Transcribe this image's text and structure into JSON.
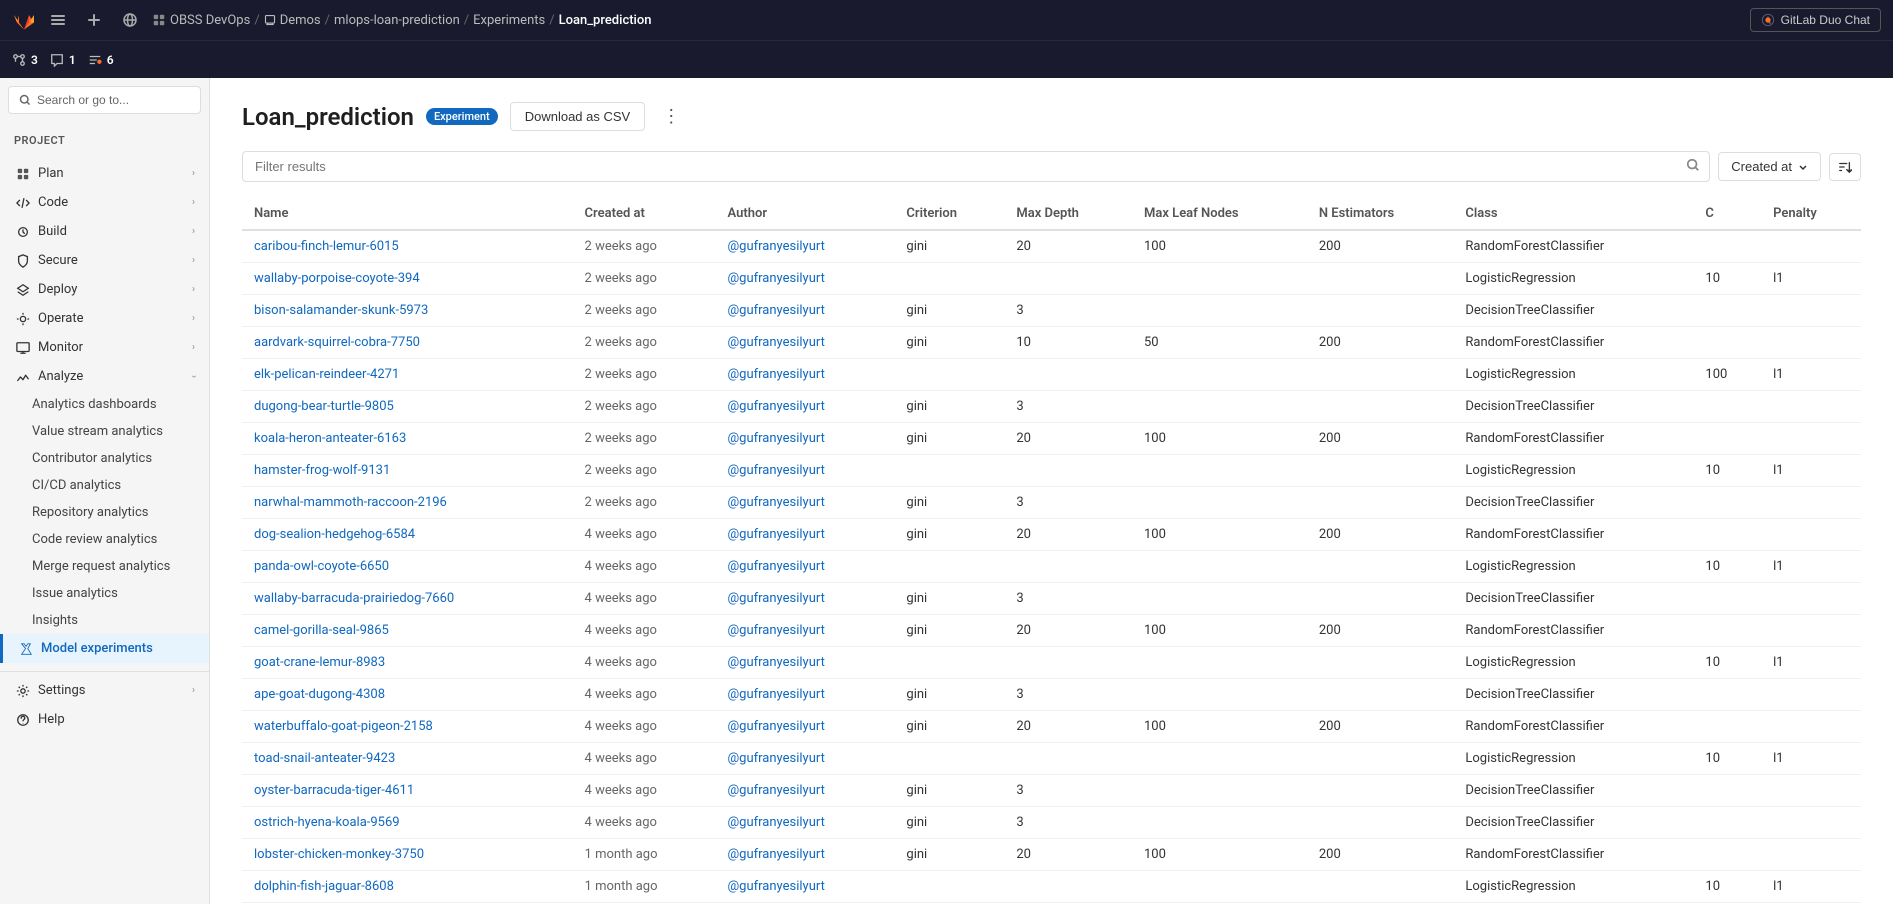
{
  "topbar": {
    "breadcrumbs": [
      {
        "label": "OBSS DevOps",
        "href": "#"
      },
      {
        "label": "Demos",
        "href": "#"
      },
      {
        "label": "mlops-loan-prediction",
        "href": "#"
      },
      {
        "label": "Experiments",
        "href": "#"
      },
      {
        "label": "Loan_prediction",
        "href": "#",
        "current": true
      }
    ],
    "duo_chat_label": "GitLab Duo Chat"
  },
  "notif_bar": {
    "items": [
      {
        "icon": "merge-request-icon",
        "count": "3",
        "label": "3"
      },
      {
        "icon": "code-review-icon",
        "count": "1",
        "label": "1"
      },
      {
        "icon": "todo-icon",
        "count": "6",
        "label": "6"
      }
    ]
  },
  "sidebar": {
    "search_placeholder": "Search or go to...",
    "project_label": "Project",
    "nav_items": [
      {
        "label": "Plan",
        "has_children": true
      },
      {
        "label": "Code",
        "has_children": true
      },
      {
        "label": "Build",
        "has_children": true
      },
      {
        "label": "Secure",
        "has_children": true
      },
      {
        "label": "Deploy",
        "has_children": true
      },
      {
        "label": "Operate",
        "has_children": true
      },
      {
        "label": "Monitor",
        "has_children": true
      },
      {
        "label": "Analyze",
        "has_children": true,
        "expanded": true
      }
    ],
    "analyze_sub_items": [
      {
        "label": "Analytics dashboards",
        "active": false
      },
      {
        "label": "Value stream analytics",
        "active": false
      },
      {
        "label": "Contributor analytics",
        "active": false
      },
      {
        "label": "CI/CD analytics",
        "active": false
      },
      {
        "label": "Repository analytics",
        "active": false
      },
      {
        "label": "Code review analytics",
        "active": false
      },
      {
        "label": "Merge request analytics",
        "active": false
      },
      {
        "label": "Issue analytics",
        "active": false
      },
      {
        "label": "Insights",
        "active": false
      }
    ],
    "model_experiments_label": "Model experiments",
    "settings_label": "Settings",
    "help_label": "Help"
  },
  "page": {
    "title": "Loan_prediction",
    "badge": "Experiment",
    "download_btn": "Download as CSV",
    "filter_placeholder": "Filter results",
    "sort_label": "Created at",
    "sort_icon": "⇅"
  },
  "table": {
    "columns": [
      "Name",
      "Created at",
      "Author",
      "Criterion",
      "Max Depth",
      "Max Leaf Nodes",
      "N Estimators",
      "Class",
      "C",
      "Penalty"
    ],
    "rows": [
      {
        "name": "caribou-finch-lemur-6015",
        "created_at": "2 weeks ago",
        "author": "@gufranyesilyurt",
        "criterion": "gini",
        "max_depth": "20",
        "max_leaf_nodes": "100",
        "n_estimators": "200",
        "class": "RandomForestClassifier",
        "c": "",
        "penalty": ""
      },
      {
        "name": "wallaby-porpoise-coyote-394",
        "created_at": "2 weeks ago",
        "author": "@gufranyesilyurt",
        "criterion": "",
        "max_depth": "",
        "max_leaf_nodes": "",
        "n_estimators": "",
        "class": "LogisticRegression",
        "c": "10",
        "penalty": "l1"
      },
      {
        "name": "bison-salamander-skunk-5973",
        "created_at": "2 weeks ago",
        "author": "@gufranyesilyurt",
        "criterion": "gini",
        "max_depth": "3",
        "max_leaf_nodes": "",
        "n_estimators": "",
        "class": "DecisionTreeClassifier",
        "c": "",
        "penalty": ""
      },
      {
        "name": "aardvark-squirrel-cobra-7750",
        "created_at": "2 weeks ago",
        "author": "@gufranyesilyurt",
        "criterion": "gini",
        "max_depth": "10",
        "max_leaf_nodes": "50",
        "n_estimators": "200",
        "class": "RandomForestClassifier",
        "c": "",
        "penalty": ""
      },
      {
        "name": "elk-pelican-reindeer-4271",
        "created_at": "2 weeks ago",
        "author": "@gufranyesilyurt",
        "criterion": "",
        "max_depth": "",
        "max_leaf_nodes": "",
        "n_estimators": "",
        "class": "LogisticRegression",
        "c": "100",
        "penalty": "l1"
      },
      {
        "name": "dugong-bear-turtle-9805",
        "created_at": "2 weeks ago",
        "author": "@gufranyesilyurt",
        "criterion": "gini",
        "max_depth": "3",
        "max_leaf_nodes": "",
        "n_estimators": "",
        "class": "DecisionTreeClassifier",
        "c": "",
        "penalty": ""
      },
      {
        "name": "koala-heron-anteater-6163",
        "created_at": "2 weeks ago",
        "author": "@gufranyesilyurt",
        "criterion": "gini",
        "max_depth": "20",
        "max_leaf_nodes": "100",
        "n_estimators": "200",
        "class": "RandomForestClassifier",
        "c": "",
        "penalty": ""
      },
      {
        "name": "hamster-frog-wolf-9131",
        "created_at": "2 weeks ago",
        "author": "@gufranyesilyurt",
        "criterion": "",
        "max_depth": "",
        "max_leaf_nodes": "",
        "n_estimators": "",
        "class": "LogisticRegression",
        "c": "10",
        "penalty": "l1"
      },
      {
        "name": "narwhal-mammoth-raccoon-2196",
        "created_at": "2 weeks ago",
        "author": "@gufranyesilyurt",
        "criterion": "gini",
        "max_depth": "3",
        "max_leaf_nodes": "",
        "n_estimators": "",
        "class": "DecisionTreeClassifier",
        "c": "",
        "penalty": ""
      },
      {
        "name": "dog-sealion-hedgehog-6584",
        "created_at": "4 weeks ago",
        "author": "@gufranyesilyurt",
        "criterion": "gini",
        "max_depth": "20",
        "max_leaf_nodes": "100",
        "n_estimators": "200",
        "class": "RandomForestClassifier",
        "c": "",
        "penalty": ""
      },
      {
        "name": "panda-owl-coyote-6650",
        "created_at": "4 weeks ago",
        "author": "@gufranyesilyurt",
        "criterion": "",
        "max_depth": "",
        "max_leaf_nodes": "",
        "n_estimators": "",
        "class": "LogisticRegression",
        "c": "10",
        "penalty": "l1"
      },
      {
        "name": "wallaby-barracuda-prairiedog-7660",
        "created_at": "4 weeks ago",
        "author": "@gufranyesilyurt",
        "criterion": "gini",
        "max_depth": "3",
        "max_leaf_nodes": "",
        "n_estimators": "",
        "class": "DecisionTreeClassifier",
        "c": "",
        "penalty": ""
      },
      {
        "name": "camel-gorilla-seal-9865",
        "created_at": "4 weeks ago",
        "author": "@gufranyesilyurt",
        "criterion": "gini",
        "max_depth": "20",
        "max_leaf_nodes": "100",
        "n_estimators": "200",
        "class": "RandomForestClassifier",
        "c": "",
        "penalty": ""
      },
      {
        "name": "goat-crane-lemur-8983",
        "created_at": "4 weeks ago",
        "author": "@gufranyesilyurt",
        "criterion": "",
        "max_depth": "",
        "max_leaf_nodes": "",
        "n_estimators": "",
        "class": "LogisticRegression",
        "c": "10",
        "penalty": "l1"
      },
      {
        "name": "ape-goat-dugong-4308",
        "created_at": "4 weeks ago",
        "author": "@gufranyesilyurt",
        "criterion": "gini",
        "max_depth": "3",
        "max_leaf_nodes": "",
        "n_estimators": "",
        "class": "DecisionTreeClassifier",
        "c": "",
        "penalty": ""
      },
      {
        "name": "waterbuffalo-goat-pigeon-2158",
        "created_at": "4 weeks ago",
        "author": "@gufranyesilyurt",
        "criterion": "gini",
        "max_depth": "20",
        "max_leaf_nodes": "100",
        "n_estimators": "200",
        "class": "RandomForestClassifier",
        "c": "",
        "penalty": ""
      },
      {
        "name": "toad-snail-anteater-9423",
        "created_at": "4 weeks ago",
        "author": "@gufranyesilyurt",
        "criterion": "",
        "max_depth": "",
        "max_leaf_nodes": "",
        "n_estimators": "",
        "class": "LogisticRegression",
        "c": "10",
        "penalty": "l1"
      },
      {
        "name": "oyster-barracuda-tiger-4611",
        "created_at": "4 weeks ago",
        "author": "@gufranyesilyurt",
        "criterion": "gini",
        "max_depth": "3",
        "max_leaf_nodes": "",
        "n_estimators": "",
        "class": "DecisionTreeClassifier",
        "c": "",
        "penalty": ""
      },
      {
        "name": "ostrich-hyena-koala-9569",
        "created_at": "4 weeks ago",
        "author": "@gufranyesilyurt",
        "criterion": "gini",
        "max_depth": "3",
        "max_leaf_nodes": "",
        "n_estimators": "",
        "class": "DecisionTreeClassifier",
        "c": "",
        "penalty": ""
      },
      {
        "name": "lobster-chicken-monkey-3750",
        "created_at": "1 month ago",
        "author": "@gufranyesilyurt",
        "criterion": "gini",
        "max_depth": "20",
        "max_leaf_nodes": "100",
        "n_estimators": "200",
        "class": "RandomForestClassifier",
        "c": "",
        "penalty": ""
      },
      {
        "name": "dolphin-fish-jaguar-8608",
        "created_at": "1 month ago",
        "author": "@gufranyesilyurt",
        "criterion": "",
        "max_depth": "",
        "max_leaf_nodes": "",
        "n_estimators": "",
        "class": "LogisticRegression",
        "c": "10",
        "penalty": "l1"
      }
    ]
  }
}
